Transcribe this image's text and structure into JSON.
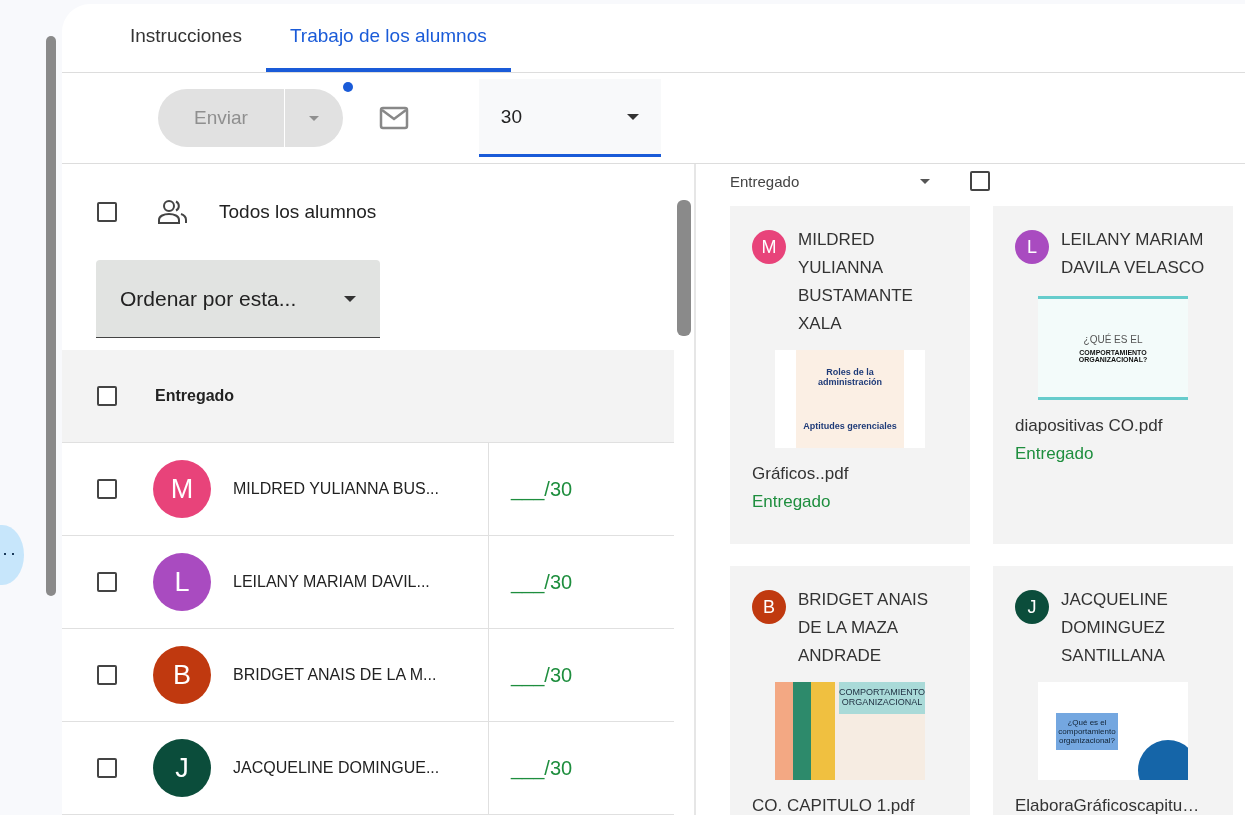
{
  "tabs": [
    {
      "label": "Instrucciones",
      "selected": false
    },
    {
      "label": "Trabajo de los alumnos",
      "selected": true
    }
  ],
  "toolbar": {
    "send_button": {
      "label": "Enviar",
      "disabled": true
    },
    "points": {
      "value": "30"
    }
  },
  "roster": {
    "all_students": {
      "label": "Todos los alumnos",
      "checked": false
    },
    "sort": {
      "value": "Ordenar por esta..."
    },
    "group": {
      "label": "Entregado",
      "checked": false
    },
    "rows": [
      {
        "initial": "M",
        "color": "#e8437a",
        "name": "MILDRED YULIANNA BUS...",
        "grade": "___/30",
        "checked": false
      },
      {
        "initial": "L",
        "color": "#a94bc0",
        "name": "LEILANY MARIAM DAVIL...",
        "grade": "___/30",
        "checked": false
      },
      {
        "initial": "B",
        "color": "#c0390f",
        "name": "BRIDGET ANAIS DE LA M...",
        "grade": "___/30",
        "checked": false
      },
      {
        "initial": "J",
        "color": "#0b4d3b",
        "name": "JACQUELINE DOMINGUE...",
        "grade": "___/30",
        "checked": false
      }
    ]
  },
  "submissions": {
    "filter": {
      "value": "Entregado",
      "checked": false
    },
    "cards": [
      {
        "initial": "M",
        "color": "#e8437a",
        "name": "MILDRED YULIANNA BUSTAMANTE XALA",
        "thumbnail": {
          "kind": "document",
          "lines": [
            "Roles de la administración",
            "Aptitudes gerenciales"
          ]
        },
        "file": "Gráficos..pdf",
        "status": "Entregado"
      },
      {
        "initial": "L",
        "color": "#a94bc0",
        "name": "LEILANY MARIAM DAVILA VELASCO",
        "thumbnail": {
          "kind": "slide",
          "lines": [
            "¿QUÉ ES EL",
            "COMPORTAMIENTO ORGANIZACIONAL?"
          ]
        },
        "file": "diapositivas CO.pdf",
        "status": "Entregado"
      },
      {
        "initial": "B",
        "color": "#c0390f",
        "name": "BRIDGET ANAIS DE LA MAZA ANDRADE",
        "thumbnail": {
          "kind": "illustrated",
          "lines": [
            "COMPORTAMIENTO ORGANIZACIONAL"
          ]
        },
        "file": "CO. CAPITULO 1.pdf"
      },
      {
        "initial": "J",
        "color": "#0b4d3b",
        "name": "JACQUELINE DOMINGUEZ SANTILLANA",
        "thumbnail": {
          "kind": "bluebox",
          "lines": [
            "¿Qué es el comportamiento organizacional?"
          ]
        },
        "file": "ElaboraGráficoscapitu…"
      }
    ]
  }
}
